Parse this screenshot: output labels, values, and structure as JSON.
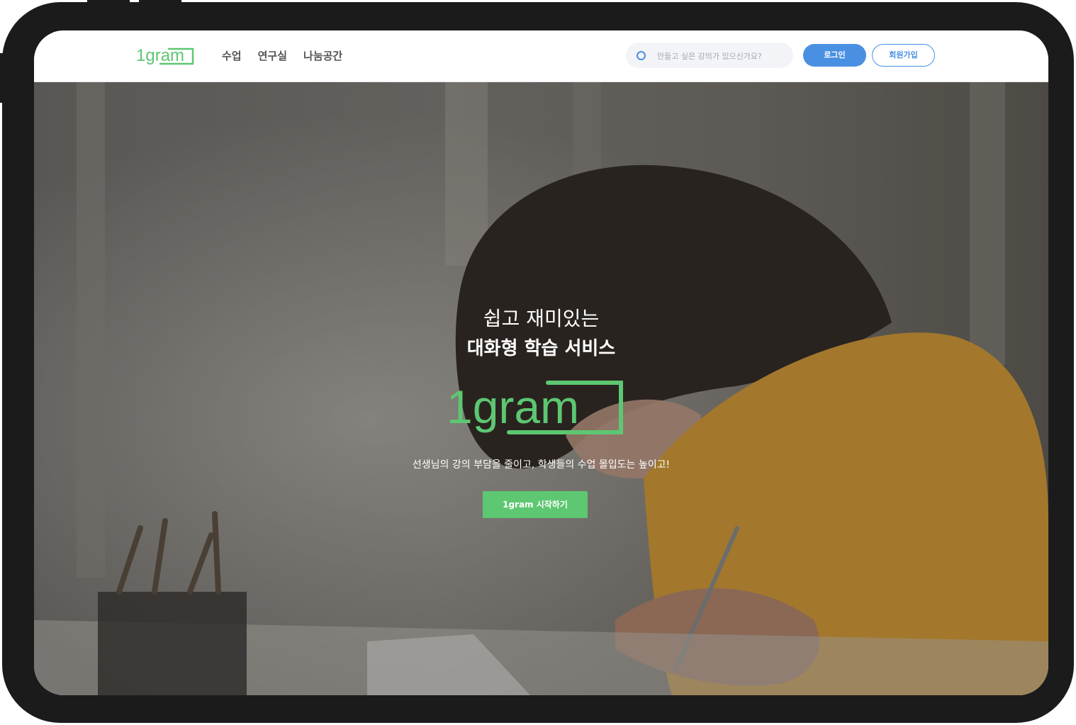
{
  "brand": {
    "name": "1gram",
    "color": "#5dc772"
  },
  "nav": {
    "items": [
      "수업",
      "연구실",
      "나눔공간"
    ]
  },
  "search": {
    "placeholder": "만들고 싶은 강의가 있으신가요?",
    "icon": "search-icon"
  },
  "auth": {
    "login_label": "로그인",
    "signup_label": "회원가입",
    "accent": "#4a90e2"
  },
  "hero": {
    "headline_light": "쉽고 재미있는",
    "headline_bold": "대화형 학습 서비스",
    "subtitle": "선생님의 강의 부담을 줄이고, 학생들의 수업 몰입도는 높이고!",
    "cta_label": "1gram 시작하기",
    "cta_color": "#5dc772"
  }
}
